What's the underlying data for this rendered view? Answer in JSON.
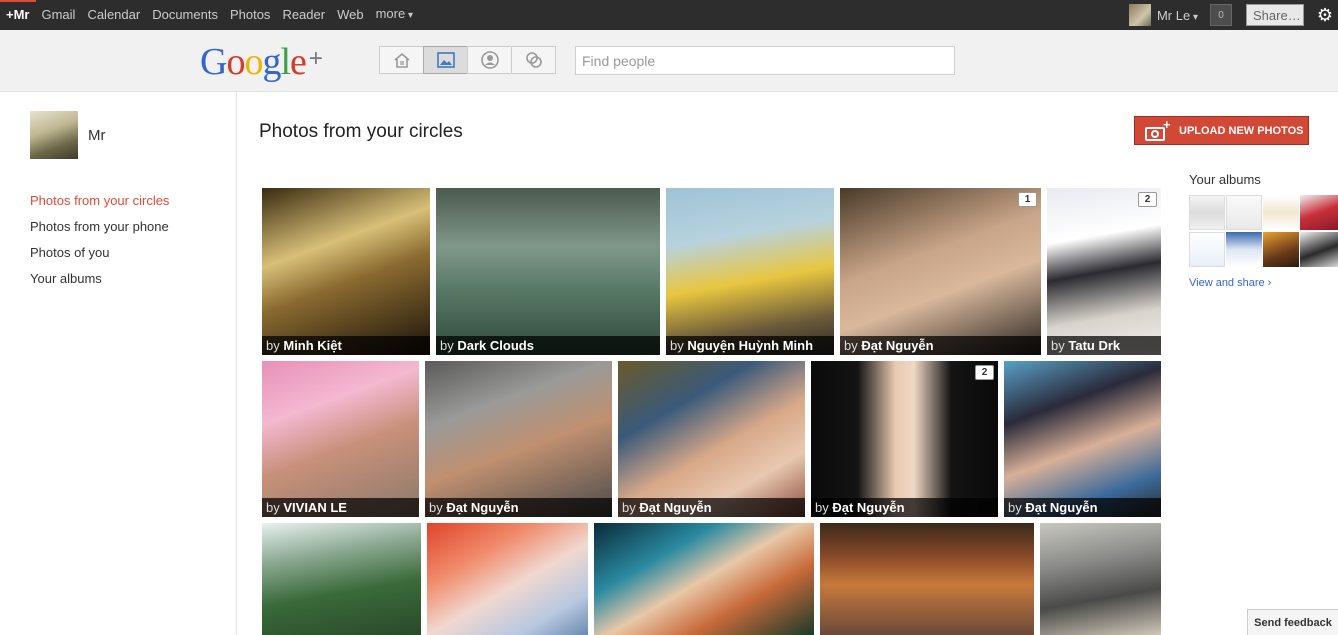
{
  "topbar": {
    "me": "+Mr",
    "nav": [
      "Gmail",
      "Calendar",
      "Documents",
      "Photos",
      "Reader",
      "Web",
      "more"
    ],
    "user_name": "Mr Le",
    "notification_count": "0",
    "share_label": "Share…",
    "settings_icon": "gear-icon"
  },
  "header": {
    "logo_text": "Google",
    "logo_plus": "+",
    "nav_icons": [
      "home-icon",
      "photos-icon",
      "profile-icon",
      "circles-icon"
    ],
    "search_placeholder": "Find people"
  },
  "sidebar": {
    "profile_name": "Mr",
    "items": [
      {
        "label": "Photos from your circles",
        "active": true
      },
      {
        "label": "Photos from your phone",
        "active": false
      },
      {
        "label": "Photos of you",
        "active": false
      },
      {
        "label": "Your albums",
        "active": false
      }
    ]
  },
  "main": {
    "title": "Photos from your circles",
    "upload_label": "UPLOAD NEW PHOTOS",
    "by_label": "by",
    "photos": [
      {
        "author": "Minh Kiệt",
        "comments": null
      },
      {
        "author": "Dark Clouds",
        "comments": null
      },
      {
        "author": "Nguyện Huỳnh Minh",
        "comments": null
      },
      {
        "author": "Đạt Nguyễn",
        "comments": "1"
      },
      {
        "author": "Tatu Drk",
        "comments": "2"
      },
      {
        "author": "VIVIAN LE",
        "comments": null
      },
      {
        "author": "Đạt Nguyễn",
        "comments": null
      },
      {
        "author": "Đạt Nguyễn",
        "comments": null
      },
      {
        "author": "Đạt Nguyễn",
        "comments": "2"
      },
      {
        "author": "Đạt Nguyễn",
        "comments": null
      }
    ]
  },
  "right": {
    "albums_title": "Your albums",
    "view_share": "View and share ›"
  },
  "feedback_label": "Send feedback"
}
